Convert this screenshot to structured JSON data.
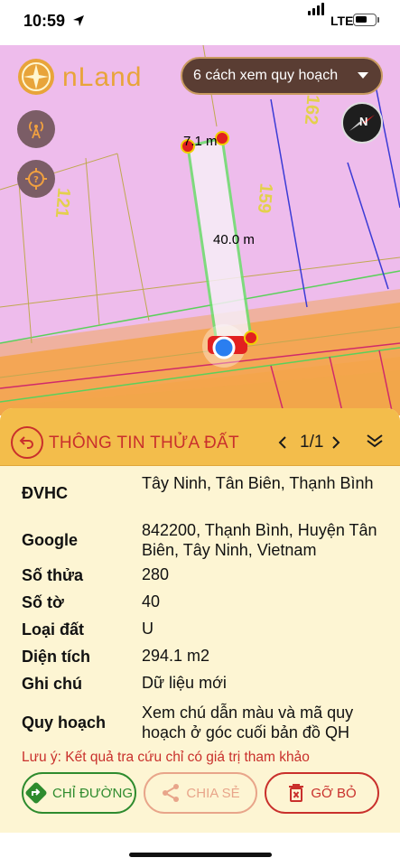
{
  "status_bar": {
    "time": "10:59",
    "network": "LTE"
  },
  "app": {
    "logo_text": "nLand"
  },
  "map": {
    "view_button_label": "6 cách xem quy hoạch",
    "measure_top": "7.1 m",
    "measure_side": "40.0 m",
    "plot_labels": [
      "121",
      "159",
      "162"
    ],
    "compass_letter": "N"
  },
  "panel": {
    "title": "THÔNG TIN THỬA ĐẤT",
    "pager": "1/1",
    "rows": [
      {
        "label": "ĐVHC",
        "value": "Tây Ninh, Tân Biên, Thạnh Bình"
      },
      {
        "label": "Google",
        "value": "842200, Thạnh Bình, Huyện Tân Biên, Tây Ninh, Vietnam"
      },
      {
        "label": "Số thửa",
        "value": "280"
      },
      {
        "label": "Số tờ",
        "value": "40"
      },
      {
        "label": "Loại đất",
        "value": "U"
      },
      {
        "label": "Diện tích",
        "value": "294.1 m2"
      },
      {
        "label": "Ghi chú",
        "value": "Dữ liệu mới"
      },
      {
        "label": "Quy hoạch",
        "value": "Xem chú dẫn màu và mã quy hoạch ở góc cuối bản đồ QH"
      }
    ],
    "note": "Lưu ý: Kết quả tra cứu chỉ có giá trị tham khảo",
    "actions": {
      "directions": "CHỈ ĐƯỜNG",
      "share": "CHIA SẺ",
      "remove": "GỠ BỎ"
    }
  },
  "colors": {
    "accent_red": "#c9302c",
    "panel_header": "#f3bd4b",
    "panel_bg": "#fdf5d3",
    "directions_green": "#2e8b2e",
    "share_peach": "#e8a58a",
    "map_pink": "#eebcec"
  }
}
